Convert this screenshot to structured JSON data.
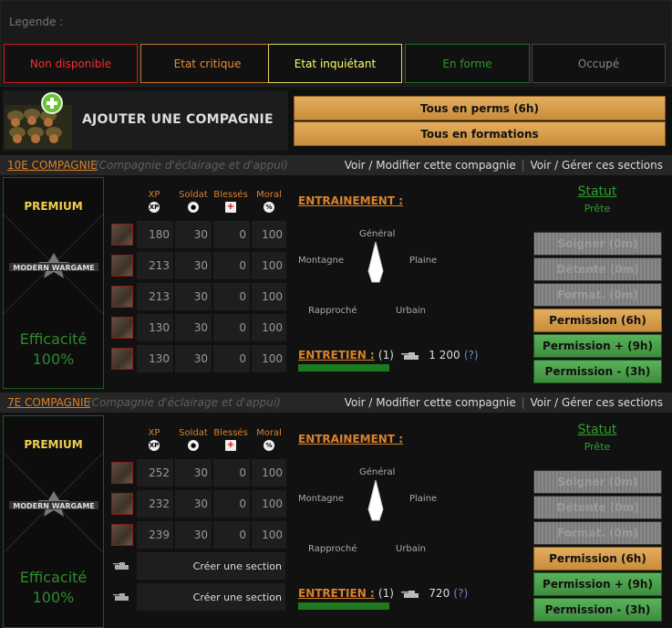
{
  "legend": {
    "title": "Legende :",
    "items": [
      {
        "label": "Non disponible",
        "color": "#ff2a2a",
        "border": "#c81e1e"
      },
      {
        "label": "Etat critique",
        "color": "#f08a30",
        "border": "#c8762a"
      },
      {
        "label": "Etat inquiétant",
        "color": "#ffff66",
        "border": "#d8d85a"
      },
      {
        "label": "En forme",
        "color": "#2a9a2a",
        "border": "#1e6a1e"
      },
      {
        "label": "Occupé",
        "color": "#888888",
        "border": "#444444"
      }
    ]
  },
  "toolbar": {
    "add_company": "AJOUTER UNE COMPAGNIE",
    "all_perms": "Tous en perms (6h)",
    "all_formations": "Tous en formations"
  },
  "headers": {
    "xp": "XP",
    "soldat": "Soldat",
    "blesses": "Blessés",
    "moral": "Moral"
  },
  "common": {
    "premium": "PREMIUM",
    "efficacite": "Efficacité",
    "entrainement": "ENTRAINEMENT :",
    "entretien": "ENTRETIEN :",
    "question": "(?)",
    "statut": "Statut",
    "link_modify": "Voir / Modifier cette compagnie",
    "link_sections": "Voir / Gérer ces sections",
    "link_sep": "|",
    "create_section": "Créer une section",
    "radar": {
      "general": "Général",
      "plaine": "Plaine",
      "montagne": "Montagne",
      "rapproche": "Rapproché",
      "urbain": "Urbain"
    },
    "buttons": [
      "Soigner (0m)",
      "Détente (0m)",
      "Format. (0m)",
      "Permission (6h)",
      "Permission + (9h)",
      "Permission - (3h)"
    ]
  },
  "companies": [
    {
      "name": "10E COMPAGNIE",
      "desc": "(Compagnie d'éclairage et d'appui)",
      "efficacite_value": "100%",
      "entretien_count": "(1)",
      "entretien_cost": "1 200",
      "statut_value": "Prête",
      "sections": [
        {
          "xp": "180",
          "soldat": "30",
          "blesses": "0",
          "moral": "100"
        },
        {
          "xp": "213",
          "soldat": "30",
          "blesses": "0",
          "moral": "100"
        },
        {
          "xp": "213",
          "soldat": "30",
          "blesses": "0",
          "moral": "100"
        },
        {
          "xp": "130",
          "soldat": "30",
          "blesses": "0",
          "moral": "100"
        },
        {
          "xp": "130",
          "soldat": "30",
          "blesses": "0",
          "moral": "100"
        }
      ]
    },
    {
      "name": "7E COMPAGNIE",
      "desc": "(Compagnie d'éclairage et d'appui)",
      "efficacite_value": "100%",
      "entretien_count": "(1)",
      "entretien_cost": "720",
      "statut_value": "Prête",
      "sections": [
        {
          "xp": "252",
          "soldat": "30",
          "blesses": "0",
          "moral": "100"
        },
        {
          "xp": "232",
          "soldat": "30",
          "blesses": "0",
          "moral": "100"
        },
        {
          "xp": "239",
          "soldat": "30",
          "blesses": "0",
          "moral": "100"
        }
      ]
    }
  ]
}
